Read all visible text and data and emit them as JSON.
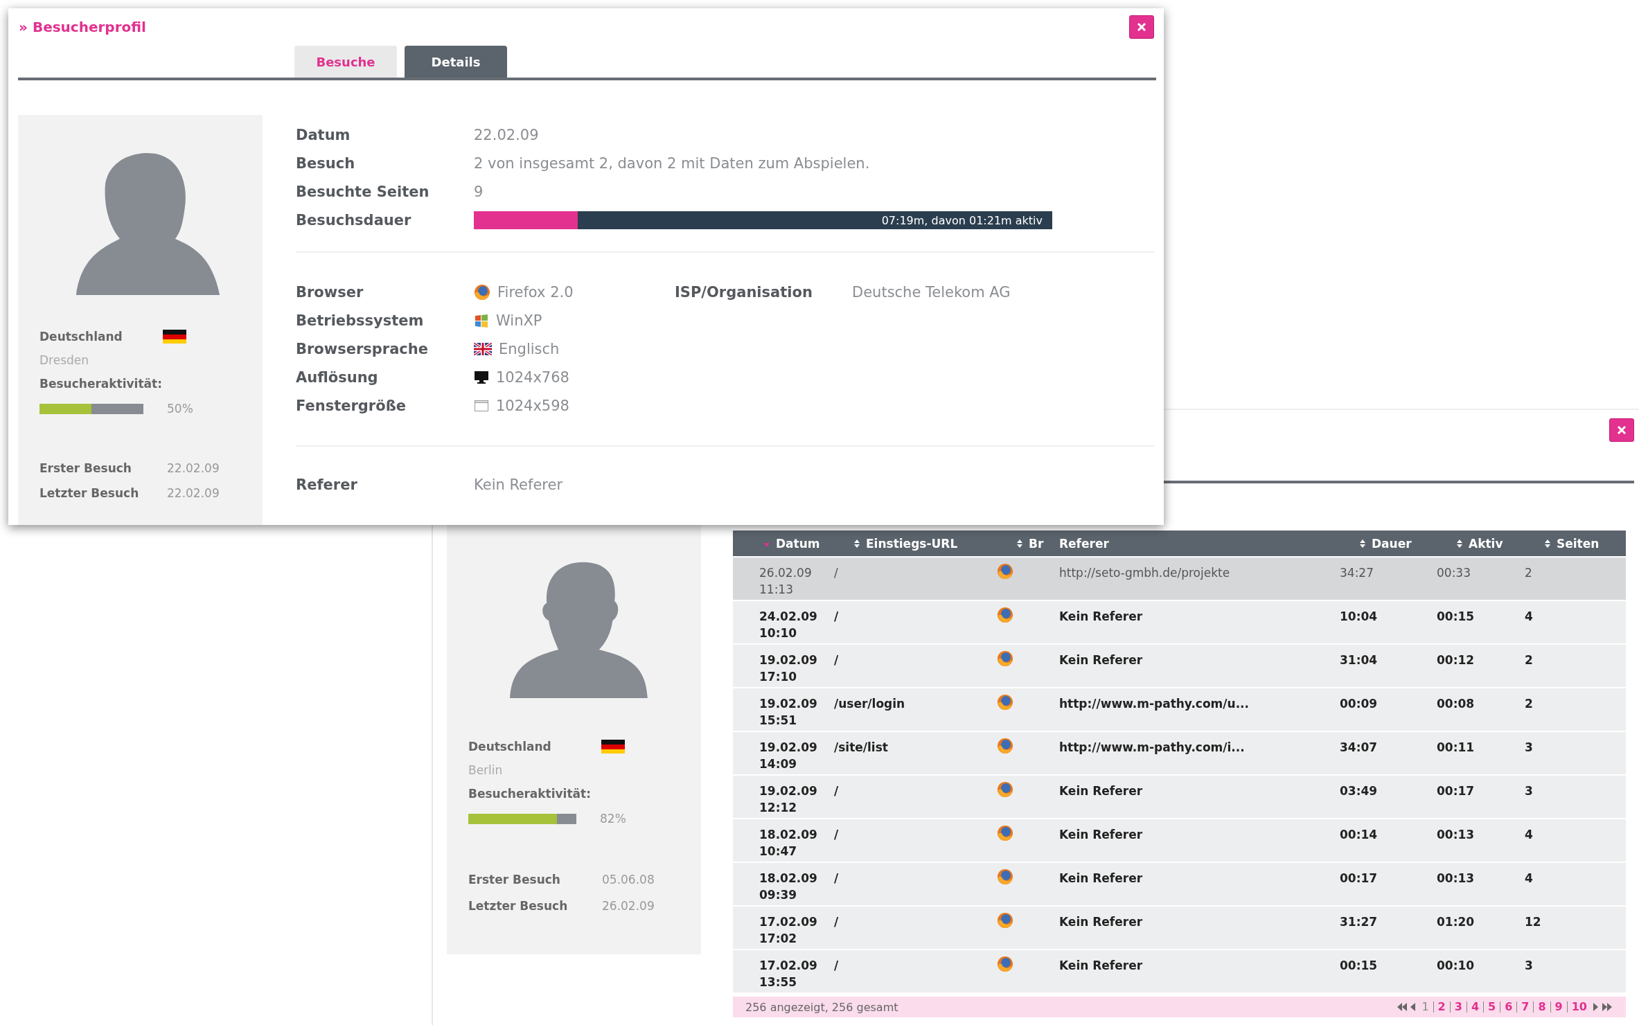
{
  "profile_window": {
    "title": "» Besucherprofil",
    "tabs": [
      {
        "label": "Besuche",
        "selected": false
      },
      {
        "label": "Details",
        "selected": true
      }
    ],
    "sidebar": {
      "country": "Deutschland",
      "city": "Dresden",
      "activity_label": "Besucheraktivität:",
      "activity": {
        "level": 0.5,
        "reading": "50%"
      },
      "visits": [
        {
          "label": "Erster Besuch",
          "value": "22.02.09"
        },
        {
          "label": "Letzter Besuch",
          "value": "22.02.09"
        }
      ]
    },
    "summary": [
      {
        "label": "Datum",
        "value": "22.02.09"
      },
      {
        "label": "Besuch",
        "value": "2 von insgesamt 2, davon 2 mit Daten zum Abspielen."
      },
      {
        "label": "Besuchte Seiten",
        "value": "9"
      }
    ],
    "duration": {
      "label": "Besuchsdauer",
      "level": 0.18,
      "reading": "07:19m, davon 01:21m aktiv"
    },
    "client": [
      {
        "kind": "browser",
        "label": "Browser",
        "value": "Firefox 2.0"
      },
      {
        "kind": "os",
        "label": "Betriebssystem",
        "value": "WinXP"
      },
      {
        "kind": "language",
        "label": "Browsersprache",
        "value": "Englisch"
      },
      {
        "kind": "resolution",
        "label": "Auflösung",
        "value": "1024x768"
      },
      {
        "kind": "window",
        "label": "Fenstergröße",
        "value": "1024x598"
      }
    ],
    "isp": {
      "label": "ISP/Organisation",
      "value": "Deutsche Telekom AG"
    },
    "referer": {
      "label": "Referer",
      "value": "Kein Referer"
    }
  },
  "visits_window": {
    "sidebar": {
      "country": "Deutschland",
      "city": "Berlin",
      "activity_label": "Besucheraktivität:",
      "activity": {
        "level": 0.82,
        "reading": "82%"
      },
      "visits": [
        {
          "label": "Erster Besuch",
          "value": "05.06.08"
        },
        {
          "label": "Letzter Besuch",
          "value": "26.02.09"
        }
      ]
    },
    "table": {
      "columns": [
        {
          "label": "Datum",
          "sortable": true,
          "sorted": true
        },
        {
          "label": "Einstiegs-URL",
          "sortable": true,
          "sorted": false
        },
        {
          "label": "Br",
          "sortable": true,
          "sorted": false
        },
        {
          "label": "Referer",
          "sortable": false,
          "sorted": false
        },
        {
          "label": "Dauer",
          "sortable": true,
          "sorted": false
        },
        {
          "label": "Aktiv",
          "sortable": true,
          "sorted": false
        },
        {
          "label": "Seiten",
          "sortable": true,
          "sorted": false
        }
      ],
      "rows": [
        {
          "selected": true,
          "datum": "26.02.09\n11:13",
          "url": "/",
          "referer": "http://seto-gmbh.de/projekte",
          "dauer": "34:27",
          "aktiv": "00:33",
          "seiten": "2"
        },
        {
          "selected": false,
          "datum": "24.02.09\n10:10",
          "url": "/",
          "referer": "Kein Referer",
          "dauer": "10:04",
          "aktiv": "00:15",
          "seiten": "4"
        },
        {
          "selected": false,
          "datum": "19.02.09\n17:10",
          "url": "/",
          "referer": "Kein Referer",
          "dauer": "31:04",
          "aktiv": "00:12",
          "seiten": "2"
        },
        {
          "selected": false,
          "datum": "19.02.09\n15:51",
          "url": "/user/login",
          "referer": "http://www.m-pathy.com/u...",
          "dauer": "00:09",
          "aktiv": "00:08",
          "seiten": "2"
        },
        {
          "selected": false,
          "datum": "19.02.09\n14:09",
          "url": "/site/list",
          "referer": "http://www.m-pathy.com/i...",
          "dauer": "34:07",
          "aktiv": "00:11",
          "seiten": "3"
        },
        {
          "selected": false,
          "datum": "19.02.09\n12:12",
          "url": "/",
          "referer": "Kein Referer",
          "dauer": "03:49",
          "aktiv": "00:17",
          "seiten": "3"
        },
        {
          "selected": false,
          "datum": "18.02.09\n10:47",
          "url": "/",
          "referer": "Kein Referer",
          "dauer": "00:14",
          "aktiv": "00:13",
          "seiten": "4"
        },
        {
          "selected": false,
          "datum": "18.02.09\n09:39",
          "url": "/",
          "referer": "Kein Referer",
          "dauer": "00:17",
          "aktiv": "00:13",
          "seiten": "4"
        },
        {
          "selected": false,
          "datum": "17.02.09\n17:02",
          "url": "/",
          "referer": "Kein Referer",
          "dauer": "31:27",
          "aktiv": "01:20",
          "seiten": "12"
        },
        {
          "selected": false,
          "datum": "17.02.09\n13:55",
          "url": "/",
          "referer": "Kein Referer",
          "dauer": "00:15",
          "aktiv": "00:10",
          "seiten": "3"
        }
      ],
      "footer": {
        "summary": "256 angezeigt, 256 gesamt",
        "pages": [
          {
            "label": "1",
            "selected": true
          },
          {
            "label": "2",
            "selected": false
          },
          {
            "label": "3",
            "selected": false
          },
          {
            "label": "4",
            "selected": false
          },
          {
            "label": "5",
            "selected": false
          },
          {
            "label": "6",
            "selected": false
          },
          {
            "label": "7",
            "selected": false
          },
          {
            "label": "8",
            "selected": false
          },
          {
            "label": "9",
            "selected": false
          },
          {
            "label": "10",
            "selected": false
          }
        ]
      }
    }
  }
}
